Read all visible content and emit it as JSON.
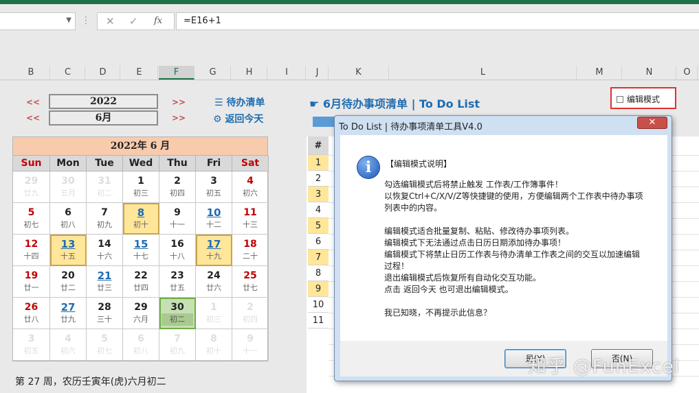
{
  "formula_bar": {
    "name_box": "",
    "cancel_icon": "✕",
    "enter_icon": "✓",
    "fx_label": "fx",
    "formula": "=E16+1"
  },
  "columns": [
    "B",
    "C",
    "D",
    "E",
    "F",
    "G",
    "H",
    "I",
    "J",
    "K",
    "L",
    "M",
    "N",
    "O"
  ],
  "selected_column": "F",
  "left": {
    "prev_year": "<<",
    "next_year": ">>",
    "prev_month": "<<",
    "next_month": ">>",
    "year": "2022",
    "month": "6月",
    "todo_link": "待办清单",
    "today_link": "返回今天",
    "calendar_title": "2022年 6 月",
    "weekdays": [
      "Sun",
      "Mon",
      "Tue",
      "Wed",
      "Thu",
      "Fri",
      "Sat"
    ],
    "weeks": [
      [
        [
          "29",
          "廿九"
        ],
        [
          "30",
          "五月"
        ],
        [
          "31",
          "初二"
        ],
        [
          "1",
          "初三"
        ],
        [
          "2",
          "初四"
        ],
        [
          "3",
          "初五"
        ],
        [
          "4",
          "初六"
        ]
      ],
      [
        [
          "5",
          "初七"
        ],
        [
          "6",
          "初八"
        ],
        [
          "7",
          "初九"
        ],
        [
          "8",
          "初十"
        ],
        [
          "9",
          "十一"
        ],
        [
          "10",
          "十二"
        ],
        [
          "11",
          "十三"
        ]
      ],
      [
        [
          "12",
          "十四"
        ],
        [
          "13",
          "十五"
        ],
        [
          "14",
          "十六"
        ],
        [
          "15",
          "十七"
        ],
        [
          "16",
          "十八"
        ],
        [
          "17",
          "十九"
        ],
        [
          "18",
          "二十"
        ]
      ],
      [
        [
          "19",
          "廿一"
        ],
        [
          "20",
          "廿二"
        ],
        [
          "21",
          "廿三"
        ],
        [
          "22",
          "廿四"
        ],
        [
          "23",
          "廿五"
        ],
        [
          "24",
          "廿六"
        ],
        [
          "25",
          "廿七"
        ]
      ],
      [
        [
          "26",
          "廿八"
        ],
        [
          "27",
          "廿九"
        ],
        [
          "28",
          "三十"
        ],
        [
          "29",
          "六月"
        ],
        [
          "30",
          "初二"
        ],
        [
          "1",
          "初三"
        ],
        [
          "2",
          "初四"
        ]
      ],
      [
        [
          "3",
          "初五"
        ],
        [
          "4",
          "初六"
        ],
        [
          "5",
          "初七"
        ],
        [
          "6",
          "初八"
        ],
        [
          "7",
          "初九"
        ],
        [
          "8",
          "初十"
        ],
        [
          "9",
          "十一"
        ]
      ]
    ],
    "footer": "第 27 周，农历壬寅年(虎)六月初二"
  },
  "right": {
    "todo_title": "☛ 6月待办事项清单 | To Do List",
    "edit_mode_label": "编辑模式",
    "row_header": "#",
    "rows": [
      "1",
      "2",
      "3",
      "4",
      "5",
      "6",
      "7",
      "8",
      "9",
      "10",
      "11"
    ]
  },
  "dialog": {
    "title": "To Do List | 待办事项清单工具V4.0",
    "close": "✕",
    "heading": "【编辑模式说明】",
    "lines": [
      "勾选编辑模式后将禁止触发 工作表/工作簿事件！",
      "以恢复Ctrl+C/X/V/Z等快捷键的使用，方便编辑两个工作表中待办事项",
      "列表中的内容。",
      "",
      "编辑模式适合批量复制、粘贴、修改待办事项列表。",
      "编辑模式下无法通过点击日历日期添加待办事项！",
      "编辑模式下将禁止日历工作表与待办清单工作表之间的交互以加速编辑",
      "过程！",
      "退出编辑模式后恢复所有自动化交互功能。",
      "点击 返回今天 也可退出编辑模式。",
      "",
      "我已知晓，不再提示此信息？"
    ],
    "yes_button": "是(Y)",
    "no_button": "否(N)"
  },
  "watermark": "知乎 @FunExcel",
  "colors": {
    "excel_green": "#1e7145",
    "accent_blue": "#1f6cb0",
    "weekend_red": "#c00000",
    "highlight_yellow": "#ffe699",
    "today_green": "#c6e0b4"
  }
}
